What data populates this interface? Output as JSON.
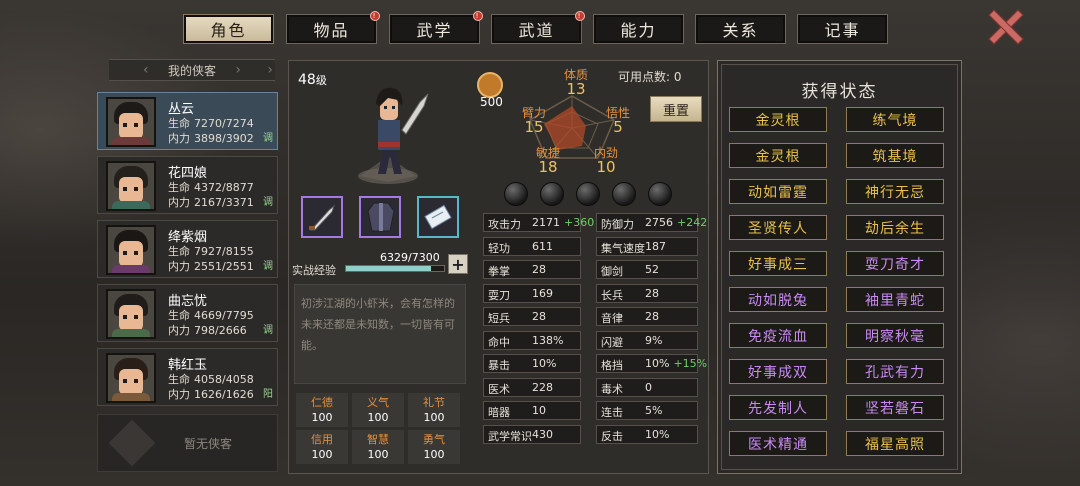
{
  "tabs": [
    {
      "label": "角色",
      "active": true,
      "badge": false
    },
    {
      "label": "物品",
      "active": false,
      "badge": true
    },
    {
      "label": "武学",
      "active": false,
      "badge": true
    },
    {
      "label": "武道",
      "active": false,
      "badge": true
    },
    {
      "label": "能力",
      "active": false,
      "badge": false
    },
    {
      "label": "关系",
      "active": false,
      "badge": false
    },
    {
      "label": "记事",
      "active": false,
      "badge": false
    }
  ],
  "badge_mark": "!",
  "roster": {
    "title": "我的侠客",
    "heroes": [
      {
        "name": "丛云",
        "hp_label": "生命",
        "hp": "7270/7274",
        "mp_label": "内力",
        "mp": "3898/3902",
        "tag": "调",
        "selected": true
      },
      {
        "name": "花四娘",
        "hp_label": "生命",
        "hp": "4372/8877",
        "mp_label": "内力",
        "mp": "2167/3371",
        "tag": "调",
        "selected": false
      },
      {
        "name": "绛紫烟",
        "hp_label": "生命",
        "hp": "7927/8155",
        "mp_label": "内力",
        "mp": "2551/2551",
        "tag": "调",
        "selected": false
      },
      {
        "name": "曲忘忧",
        "hp_label": "生命",
        "hp": "4669/7795",
        "mp_label": "内力",
        "mp": "798/2666",
        "tag": "调",
        "selected": false
      },
      {
        "name": "韩红玉",
        "hp_label": "生命",
        "hp": "4058/4058",
        "mp_label": "内力",
        "mp": "1626/1626",
        "tag": "阳",
        "selected": false
      }
    ],
    "empty_label": "暂无侠客"
  },
  "character": {
    "level_num": "48",
    "level_unit": "级",
    "potential": "500",
    "attributes": {
      "constitution": {
        "label": "体质",
        "value": "13"
      },
      "arm": {
        "label": "臂力",
        "value": "15"
      },
      "insight": {
        "label": "悟性",
        "value": "5"
      },
      "agility": {
        "label": "敏捷",
        "value": "18"
      },
      "inner": {
        "label": "内劲",
        "value": "10"
      }
    },
    "points_text": "可用点数: 0",
    "reset_label": "重置",
    "xp_label": "实战经验",
    "xp_text": "6329/7300",
    "xp_fraction": 0.867,
    "xp_plus": "+",
    "description": "初涉江湖的小虾米，会有怎样的未来还都是未知数，一切皆有可能。",
    "virtues": [
      {
        "label": "仁德",
        "value": "100"
      },
      {
        "label": "义气",
        "value": "100"
      },
      {
        "label": "礼节",
        "value": "100"
      },
      {
        "label": "信用",
        "value": "100"
      },
      {
        "label": "智慧",
        "value": "100"
      },
      {
        "label": "勇气",
        "value": "100"
      }
    ],
    "stats_left": [
      {
        "name": "攻击力",
        "value": "2171",
        "bonus": "+360"
      },
      {
        "name": "轻功",
        "value": "611",
        "bonus": ""
      },
      {
        "name": "拳掌",
        "value": "28",
        "bonus": ""
      },
      {
        "name": "耍刀",
        "value": "169",
        "bonus": ""
      },
      {
        "name": "短兵",
        "value": "28",
        "bonus": ""
      },
      {
        "name": "命中",
        "value": "138%",
        "bonus": ""
      },
      {
        "name": "暴击",
        "value": "10%",
        "bonus": ""
      },
      {
        "name": "医术",
        "value": "228",
        "bonus": ""
      },
      {
        "name": "暗器",
        "value": "10",
        "bonus": ""
      },
      {
        "name": "武学常识",
        "value": "430",
        "bonus": ""
      }
    ],
    "stats_right": [
      {
        "name": "防御力",
        "value": "2756",
        "bonus": "+242"
      },
      {
        "name": "集气速度",
        "value": "187",
        "bonus": ""
      },
      {
        "name": "御剑",
        "value": "52",
        "bonus": ""
      },
      {
        "name": "长兵",
        "value": "28",
        "bonus": ""
      },
      {
        "name": "音律",
        "value": "28",
        "bonus": ""
      },
      {
        "name": "闪避",
        "value": "9%",
        "bonus": ""
      },
      {
        "name": "格挡",
        "value": "10%",
        "bonus": "+15%"
      },
      {
        "name": "毒术",
        "value": "0",
        "bonus": ""
      },
      {
        "name": "连击",
        "value": "5%",
        "bonus": ""
      },
      {
        "name": "反击",
        "value": "10%",
        "bonus": ""
      }
    ]
  },
  "status_panel": {
    "title": "获得状态",
    "items": [
      {
        "label": "金灵根",
        "color": "gold"
      },
      {
        "label": "练气境",
        "color": "gold"
      },
      {
        "label": "金灵根",
        "color": "gold"
      },
      {
        "label": "筑基境",
        "color": "gold"
      },
      {
        "label": "动如雷霆",
        "color": "gold"
      },
      {
        "label": "神行无忌",
        "color": "gold"
      },
      {
        "label": "圣贤传人",
        "color": "gold"
      },
      {
        "label": "劫后余生",
        "color": "gold"
      },
      {
        "label": "好事成三",
        "color": "gold"
      },
      {
        "label": "耍刀奇才",
        "color": "purple"
      },
      {
        "label": "动如脱兔",
        "color": "purple"
      },
      {
        "label": "袖里青蛇",
        "color": "purple"
      },
      {
        "label": "免疫流血",
        "color": "purple"
      },
      {
        "label": "明察秋毫",
        "color": "purple"
      },
      {
        "label": "好事成双",
        "color": "purple"
      },
      {
        "label": "孔武有力",
        "color": "purple"
      },
      {
        "label": "先发制人",
        "color": "purple"
      },
      {
        "label": "坚若磐石",
        "color": "purple"
      },
      {
        "label": "医术精通",
        "color": "purple"
      },
      {
        "label": "福星高照",
        "color": "gold"
      }
    ]
  },
  "colors": {
    "accent_gold": "#e9c04a",
    "accent_purple": "#c98af2",
    "orange": "#e8913d",
    "bonus_green": "#6fd06a"
  }
}
